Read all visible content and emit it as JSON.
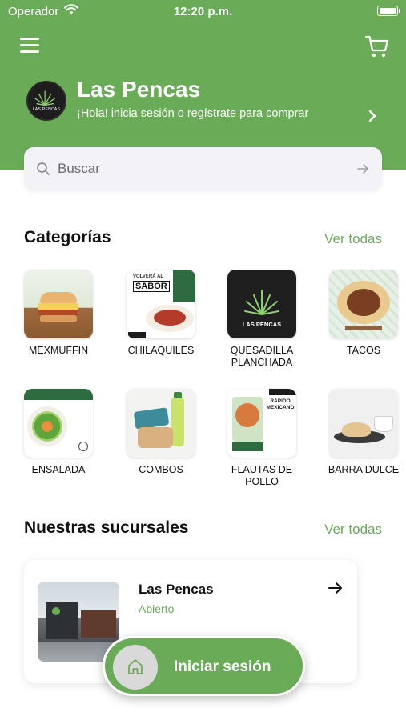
{
  "status_bar": {
    "carrier": "Operador",
    "time": "12:20 p.m."
  },
  "header": {
    "title": "Las Pencas",
    "subtitle": "¡Hola! inicia sesión o regístrate para comprar",
    "logo_text": "LAS PENCAS",
    "icons": {
      "menu": "menu-icon",
      "cart": "cart-icon",
      "chevron": "chevron-right-icon"
    }
  },
  "search": {
    "placeholder": "Buscar"
  },
  "categories": {
    "title": "Categorías",
    "see_all": "Ver todas",
    "items": [
      {
        "label": "MEXMUFFIN"
      },
      {
        "label": "CHILAQUILES"
      },
      {
        "label": "QUESADILLA PLANCHADA"
      },
      {
        "label": "TACOS"
      },
      {
        "label": "ENSALADA"
      },
      {
        "label": "COMBOS"
      },
      {
        "label": "FLAUTAS DE POLLO"
      },
      {
        "label": "BARRA DULCE"
      }
    ]
  },
  "branches": {
    "title": "Nuestras sucursales",
    "see_all": "Ver todas",
    "items": [
      {
        "name": "Las Pencas",
        "status": "Abierto"
      }
    ]
  },
  "login_button": {
    "label": "Iniciar sesión"
  },
  "colors": {
    "brand_green": "#6aab57",
    "search_bg": "#f2f2f7"
  }
}
